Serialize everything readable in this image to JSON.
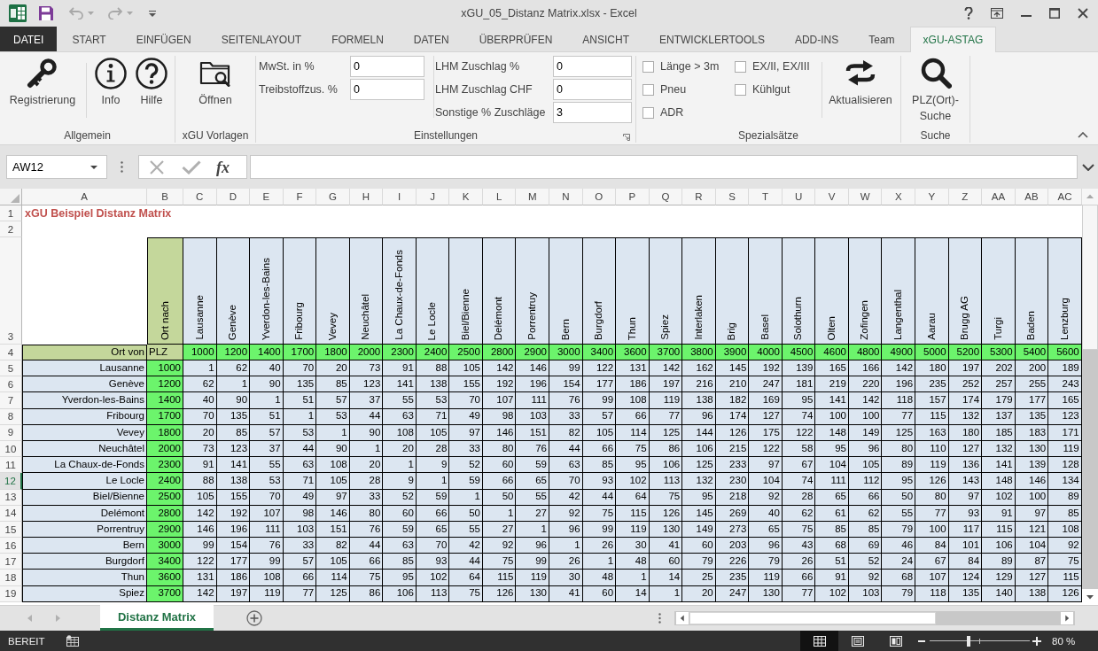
{
  "window": {
    "title": "xGU_05_Distanz Matrix.xlsx - Excel"
  },
  "quick_access": [
    {
      "kind": "save",
      "disabled": false
    },
    {
      "kind": "undo",
      "disabled": true
    },
    {
      "kind": "redo",
      "disabled": true
    }
  ],
  "tabs": [
    {
      "label": "DATEI",
      "kind": "file",
      "selected": false
    },
    {
      "label": "START",
      "kind": "tab",
      "selected": false
    },
    {
      "label": "EINFÜGEN",
      "kind": "tab",
      "selected": false
    },
    {
      "label": "SEITENLAYOUT",
      "kind": "tab",
      "selected": false
    },
    {
      "label": "FORMELN",
      "kind": "tab",
      "selected": false
    },
    {
      "label": "DATEN",
      "kind": "tab",
      "selected": false
    },
    {
      "label": "ÜBERPRÜFEN",
      "kind": "tab",
      "selected": false
    },
    {
      "label": "ANSICHT",
      "kind": "tab",
      "selected": false
    },
    {
      "label": "ENTWICKLERTOOLS",
      "kind": "tab",
      "selected": false
    },
    {
      "label": "ADD-INS",
      "kind": "tab",
      "selected": false
    },
    {
      "label": "Team",
      "kind": "tab",
      "selected": false
    },
    {
      "label": "xGU-ASTAG",
      "kind": "tab",
      "selected": true
    }
  ],
  "ribbon": {
    "general": {
      "label": "Allgemein",
      "register_button": "Registrierung",
      "info_button": "Info",
      "help_button": "Hilfe"
    },
    "templates": {
      "label": "xGU Vorlagen",
      "open_button": "Öffnen"
    },
    "settings": {
      "label": "Einstellungen",
      "fields": [
        {
          "label": "MwSt. in %",
          "value": "0"
        },
        {
          "label": "Treibstoffzus. %",
          "value": "0"
        },
        {
          "label": "LHM Zuschlag %",
          "value": "0"
        },
        {
          "label": "LHM Zuschlag CHF",
          "value": "0"
        },
        {
          "label": "Sonstige % Zuschläge",
          "value": "3"
        }
      ]
    },
    "special_rates": {
      "label": "Spezialsätze",
      "options": [
        {
          "label": "Länge > 3m",
          "checked": false
        },
        {
          "label": "Pneu",
          "checked": false
        },
        {
          "label": "ADR",
          "checked": false
        },
        {
          "label": "EX/II, EX/III",
          "checked": false
        },
        {
          "label": "Kühlgut",
          "checked": false
        }
      ],
      "refresh_button": "Aktualisieren"
    },
    "search": {
      "label": "Suche",
      "search_button": "PLZ(Ort)-Suche"
    }
  },
  "formula_bar": {
    "name_box": "AW12",
    "insert_function": "fx",
    "editing": false
  },
  "sheet": {
    "column_headers": [
      "A",
      "B",
      "C",
      "D",
      "E",
      "F",
      "G",
      "H",
      "I",
      "J",
      "K",
      "L",
      "M",
      "N",
      "O",
      "P",
      "Q",
      "R",
      "S",
      "T",
      "U",
      "V",
      "W",
      "X",
      "Y",
      "Z",
      "AA",
      "AB",
      "AC"
    ],
    "row_headers": [
      {
        "label": "1",
        "selected": false
      },
      {
        "label": "2",
        "selected": false
      },
      {
        "label": "3",
        "selected": false
      },
      {
        "label": "4",
        "selected": false
      },
      {
        "label": "5",
        "selected": false
      },
      {
        "label": "6",
        "selected": false
      },
      {
        "label": "7",
        "selected": false
      },
      {
        "label": "8",
        "selected": false
      },
      {
        "label": "9",
        "selected": false
      },
      {
        "label": "10",
        "selected": false
      },
      {
        "label": "11",
        "selected": false
      },
      {
        "label": "12",
        "selected": true
      },
      {
        "label": "13",
        "selected": false
      },
      {
        "label": "14",
        "selected": false
      },
      {
        "label": "15",
        "selected": false
      },
      {
        "label": "16",
        "selected": false
      },
      {
        "label": "17",
        "selected": false
      },
      {
        "label": "18",
        "selected": false
      },
      {
        "label": "19",
        "selected": false
      }
    ],
    "title": "xGU Beispiel Distanz Matrix",
    "corner_label": "Ort nach",
    "origin_label": "Ort von",
    "plz_label": "PLZ",
    "destinations": [
      {
        "name": "Lausanne",
        "plz": "1000"
      },
      {
        "name": "Genève",
        "plz": "1200"
      },
      {
        "name": "Yverdon-les-Bains",
        "plz": "1400"
      },
      {
        "name": "Fribourg",
        "plz": "1700"
      },
      {
        "name": "Vevey",
        "plz": "1800"
      },
      {
        "name": "Neuchâtel",
        "plz": "2000"
      },
      {
        "name": "La Chaux-de-Fonds",
        "plz": "2300"
      },
      {
        "name": "Le Locle",
        "plz": "2400"
      },
      {
        "name": "Biel/Bienne",
        "plz": "2500"
      },
      {
        "name": "Delémont",
        "plz": "2800"
      },
      {
        "name": "Porrentruy",
        "plz": "2900"
      },
      {
        "name": "Bern",
        "plz": "3000"
      },
      {
        "name": "Burgdorf",
        "plz": "3400"
      },
      {
        "name": "Thun",
        "plz": "3600"
      },
      {
        "name": "Spiez",
        "plz": "3700"
      },
      {
        "name": "Interlaken",
        "plz": "3800"
      },
      {
        "name": "Brig",
        "plz": "3900"
      },
      {
        "name": "Basel",
        "plz": "4000"
      },
      {
        "name": "Solothurn",
        "plz": "4500"
      },
      {
        "name": "Olten",
        "plz": "4600"
      },
      {
        "name": "Zofingen",
        "plz": "4800"
      },
      {
        "name": "Langenthal",
        "plz": "4900"
      },
      {
        "name": "Aarau",
        "plz": "5000"
      },
      {
        "name": "Brugg AG",
        "plz": "5200"
      },
      {
        "name": "Turgi",
        "plz": "5300"
      },
      {
        "name": "Baden",
        "plz": "5400"
      },
      {
        "name": "Lenzburg",
        "plz": "5600"
      }
    ],
    "rows": [
      {
        "origin": "Lausanne",
        "plz": "1000",
        "distances": [
          "1",
          "62",
          "40",
          "70",
          "20",
          "73",
          "91",
          "88",
          "105",
          "142",
          "146",
          "99",
          "122",
          "131",
          "142",
          "162",
          "145",
          "192",
          "139",
          "165",
          "166",
          "142",
          "180",
          "197",
          "202",
          "200",
          "189"
        ]
      },
      {
        "origin": "Genève",
        "plz": "1200",
        "distances": [
          "62",
          "1",
          "90",
          "135",
          "85",
          "123",
          "141",
          "138",
          "155",
          "192",
          "196",
          "154",
          "177",
          "186",
          "197",
          "216",
          "210",
          "247",
          "181",
          "219",
          "220",
          "196",
          "235",
          "252",
          "257",
          "255",
          "243"
        ]
      },
      {
        "origin": "Yverdon-les-Bains",
        "plz": "1400",
        "distances": [
          "40",
          "90",
          "1",
          "51",
          "57",
          "37",
          "55",
          "53",
          "70",
          "107",
          "111",
          "76",
          "99",
          "108",
          "119",
          "138",
          "182",
          "169",
          "95",
          "141",
          "142",
          "118",
          "157",
          "174",
          "179",
          "177",
          "165"
        ]
      },
      {
        "origin": "Fribourg",
        "plz": "1700",
        "distances": [
          "70",
          "135",
          "51",
          "1",
          "53",
          "44",
          "63",
          "71",
          "49",
          "98",
          "103",
          "33",
          "57",
          "66",
          "77",
          "96",
          "174",
          "127",
          "74",
          "100",
          "100",
          "77",
          "115",
          "132",
          "137",
          "135",
          "123"
        ]
      },
      {
        "origin": "Vevey",
        "plz": "1800",
        "distances": [
          "20",
          "85",
          "57",
          "53",
          "1",
          "90",
          "108",
          "105",
          "97",
          "146",
          "151",
          "82",
          "105",
          "114",
          "125",
          "144",
          "126",
          "175",
          "122",
          "148",
          "149",
          "125",
          "163",
          "180",
          "185",
          "183",
          "171"
        ]
      },
      {
        "origin": "Neuchâtel",
        "plz": "2000",
        "distances": [
          "73",
          "123",
          "37",
          "44",
          "90",
          "1",
          "20",
          "28",
          "33",
          "80",
          "76",
          "44",
          "66",
          "75",
          "86",
          "106",
          "215",
          "122",
          "58",
          "95",
          "96",
          "80",
          "110",
          "127",
          "132",
          "130",
          "119"
        ]
      },
      {
        "origin": "La Chaux-de-Fonds",
        "plz": "2300",
        "distances": [
          "91",
          "141",
          "55",
          "63",
          "108",
          "20",
          "1",
          "9",
          "52",
          "60",
          "59",
          "63",
          "85",
          "95",
          "106",
          "125",
          "233",
          "97",
          "67",
          "104",
          "105",
          "89",
          "119",
          "136",
          "141",
          "139",
          "128"
        ]
      },
      {
        "origin": "Le Locle",
        "plz": "2400",
        "distances": [
          "88",
          "138",
          "53",
          "71",
          "105",
          "28",
          "9",
          "1",
          "59",
          "66",
          "65",
          "70",
          "93",
          "102",
          "113",
          "132",
          "230",
          "104",
          "74",
          "111",
          "112",
          "95",
          "126",
          "143",
          "148",
          "146",
          "134"
        ]
      },
      {
        "origin": "Biel/Bienne",
        "plz": "2500",
        "distances": [
          "105",
          "155",
          "70",
          "49",
          "97",
          "33",
          "52",
          "59",
          "1",
          "50",
          "55",
          "42",
          "44",
          "64",
          "75",
          "95",
          "218",
          "92",
          "28",
          "65",
          "66",
          "50",
          "80",
          "97",
          "102",
          "100",
          "89"
        ]
      },
      {
        "origin": "Delémont",
        "plz": "2800",
        "distances": [
          "142",
          "192",
          "107",
          "98",
          "146",
          "80",
          "60",
          "66",
          "50",
          "1",
          "27",
          "92",
          "75",
          "115",
          "126",
          "145",
          "269",
          "40",
          "62",
          "61",
          "62",
          "55",
          "77",
          "93",
          "91",
          "97",
          "85"
        ]
      },
      {
        "origin": "Porrentruy",
        "plz": "2900",
        "distances": [
          "146",
          "196",
          "111",
          "103",
          "151",
          "76",
          "59",
          "65",
          "55",
          "27",
          "1",
          "96",
          "99",
          "119",
          "130",
          "149",
          "273",
          "65",
          "75",
          "85",
          "85",
          "79",
          "100",
          "117",
          "115",
          "121",
          "108"
        ]
      },
      {
        "origin": "Bern",
        "plz": "3000",
        "distances": [
          "99",
          "154",
          "76",
          "33",
          "82",
          "44",
          "63",
          "70",
          "42",
          "92",
          "96",
          "1",
          "26",
          "30",
          "41",
          "60",
          "203",
          "96",
          "43",
          "68",
          "69",
          "46",
          "84",
          "101",
          "106",
          "104",
          "92"
        ]
      },
      {
        "origin": "Burgdorf",
        "plz": "3400",
        "distances": [
          "122",
          "177",
          "99",
          "57",
          "105",
          "66",
          "85",
          "93",
          "44",
          "75",
          "99",
          "26",
          "1",
          "48",
          "60",
          "79",
          "226",
          "79",
          "26",
          "51",
          "52",
          "24",
          "67",
          "84",
          "89",
          "87",
          "75"
        ]
      },
      {
        "origin": "Thun",
        "plz": "3600",
        "distances": [
          "131",
          "186",
          "108",
          "66",
          "114",
          "75",
          "95",
          "102",
          "64",
          "115",
          "119",
          "30",
          "48",
          "1",
          "14",
          "25",
          "235",
          "119",
          "66",
          "91",
          "92",
          "68",
          "107",
          "124",
          "129",
          "127",
          "115"
        ]
      },
      {
        "origin": "Spiez",
        "plz": "3700",
        "distances": [
          "142",
          "197",
          "119",
          "77",
          "125",
          "86",
          "106",
          "113",
          "75",
          "126",
          "130",
          "41",
          "60",
          "14",
          "1",
          "20",
          "247",
          "130",
          "77",
          "102",
          "103",
          "79",
          "118",
          "135",
          "140",
          "138",
          "126"
        ]
      }
    ]
  },
  "sheet_tabs": [
    {
      "label": "Distanz Matrix",
      "selected": true
    }
  ],
  "status_bar": {
    "mode": "BEREIT",
    "views": [
      {
        "kind": "normal",
        "selected": true
      },
      {
        "kind": "page_layout",
        "selected": false
      },
      {
        "kind": "page_break",
        "selected": false
      }
    ],
    "zoom": {
      "level": 0.39,
      "label": "80 %"
    }
  }
}
